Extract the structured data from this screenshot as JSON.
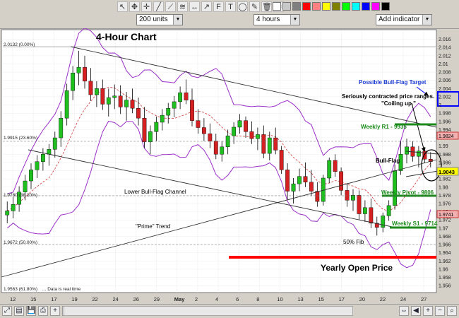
{
  "toolbar": {
    "units": "200 units",
    "interval": "4 hours",
    "indicator": "Add indicator",
    "swatches": [
      "#ffffff",
      "#c8c8c8",
      "#7f7f7f",
      "#ff0000",
      "#ff8080",
      "#ffff00",
      "#808000",
      "#00ff00",
      "#00ffff",
      "#0000ff",
      "#ff00ff",
      "#000000"
    ]
  },
  "chart_data": {
    "type": "candlestick",
    "title": "4-Hour Chart",
    "x_tick_labels": [
      "12",
      "15",
      "17",
      "19",
      "22",
      "24",
      "26",
      "29",
      "May",
      "2",
      "4",
      "6",
      "8",
      "10",
      "13",
      "15",
      "17",
      "20",
      "22",
      "24",
      "27"
    ],
    "y_tick_labels": [
      "2.016",
      "2.014",
      "2.012",
      "2.01",
      "2.008",
      "2.006",
      "2.004",
      "2.002",
      "2",
      "1.998",
      "1.996",
      "1.994",
      "1.992",
      "1.99",
      "1.988",
      "1.986",
      "1.984",
      "1.982",
      "1.98",
      "1.978",
      "1.976",
      "1.974",
      "1.972",
      "1.97",
      "1.968",
      "1.966",
      "1.964",
      "1.962",
      "1.96",
      "1.958",
      "1.956"
    ],
    "ylim": [
      1.955,
      2.018
    ],
    "level_labels": {
      "fib0": "2.0132 (0.00%)",
      "fib236": "1.9915 (23.60%)",
      "fib382": "1.9780 (38.20%)",
      "fib50": "1.9672 (50.00%)",
      "fib618": "1.9563 (61.80%)"
    },
    "price_tags": {
      "current": "1.9043",
      "r1": "1.9824",
      "s1": "1.9741"
    },
    "annotations": {
      "bull_flag_target": "Possible Bull-Flag Target",
      "contracted": "Seriously contracted price ranges.",
      "coiling": "\"Coiling up.\"",
      "weekly_r1": "Weekly R1 - 9935",
      "bull_flag": "Bull-Flag",
      "weekly_pivot": "Weekly Pivot - 9806",
      "weekly_s1": "Weekly S1 - 9714",
      "lower_channel": "Lower Bull-Flag Channel",
      "prime_trend": "\"Prime\" Trend",
      "fib50": "50% Fib",
      "yearly_open": "Yearly Open Price",
      "footer_note": "... Data is real time"
    },
    "key_levels": {
      "weekly_r1": 1.9935,
      "weekly_pivot": 1.9806,
      "weekly_s1": 1.9714,
      "yearly_open": 1.9648
    },
    "candles": [
      [
        1.9732,
        1.9765,
        1.9712,
        1.9742
      ],
      [
        1.9742,
        1.9776,
        1.9724,
        1.9758
      ],
      [
        1.9758,
        1.9802,
        1.974,
        1.9788
      ],
      [
        1.9788,
        1.983,
        1.9768,
        1.9815
      ],
      [
        1.9815,
        1.9858,
        1.9795,
        1.9842
      ],
      [
        1.9842,
        1.9878,
        1.9822,
        1.9862
      ],
      [
        1.9862,
        1.9895,
        1.984,
        1.988
      ],
      [
        1.988,
        1.9905,
        1.9852,
        1.9892
      ],
      [
        1.9892,
        1.9935,
        1.9872,
        1.992
      ],
      [
        1.992,
        1.9985,
        1.9898,
        1.9968
      ],
      [
        1.9968,
        2.0052,
        1.995,
        2.0035
      ],
      [
        2.0035,
        2.0095,
        2.0012,
        2.0078
      ],
      [
        2.0078,
        2.0132,
        2.0048,
        2.0092
      ],
      [
        2.0092,
        2.012,
        2.004,
        2.0058
      ],
      [
        2.0058,
        2.009,
        2.001,
        2.0025
      ],
      [
        2.0025,
        2.0058,
        1.9995,
        2.004
      ],
      [
        2.004,
        2.0062,
        1.9988,
        2.0002
      ],
      [
        2.0002,
        2.004,
        1.9972,
        2.0018
      ],
      [
        2.0018,
        2.005,
        1.999,
        2.0022
      ],
      [
        2.0022,
        2.0048,
        1.9978,
        1.9995
      ],
      [
        1.9995,
        2.0032,
        1.9962,
        2.0012
      ],
      [
        2.0012,
        2.004,
        1.998,
        1.9992
      ],
      [
        1.9992,
        2.0018,
        1.995,
        1.9968
      ],
      [
        1.9968,
        1.9995,
        1.9895,
        1.991
      ],
      [
        1.991,
        1.995,
        1.988,
        1.9935
      ],
      [
        1.9935,
        1.9972,
        1.9912,
        1.9958
      ],
      [
        1.9958,
        1.999,
        1.9938,
        1.9975
      ],
      [
        1.9975,
        2.0005,
        1.9955,
        1.9992
      ],
      [
        1.9992,
        2.0022,
        1.997,
        2.0008
      ],
      [
        2.0008,
        2.0045,
        1.999,
        2.003
      ],
      [
        2.003,
        2.0062,
        2.0002,
        2.0012
      ],
      [
        2.0012,
        2.004,
        1.9948,
        1.9962
      ],
      [
        1.9962,
        1.999,
        1.993,
        1.9945
      ],
      [
        1.9945,
        1.9968,
        1.9912,
        1.993
      ],
      [
        1.993,
        1.9955,
        1.9895,
        1.9912
      ],
      [
        1.9912,
        1.993,
        1.9868,
        1.988
      ],
      [
        1.988,
        1.9912,
        1.9862,
        1.9898
      ],
      [
        1.9898,
        1.994,
        1.988,
        1.9925
      ],
      [
        1.9925,
        1.9958,
        1.9905,
        1.9946
      ],
      [
        1.9946,
        1.9978,
        1.993,
        1.9962
      ],
      [
        1.9962,
        1.9972,
        1.992,
        1.9935
      ],
      [
        1.9935,
        1.996,
        1.9905,
        1.9918
      ],
      [
        1.9918,
        1.9945,
        1.989,
        1.9928
      ],
      [
        1.9928,
        1.995,
        1.987,
        1.9882
      ],
      [
        1.9882,
        1.9935,
        1.9865,
        1.992
      ],
      [
        1.992,
        1.9945,
        1.988,
        1.989
      ],
      [
        1.989,
        1.99,
        1.9832,
        1.9842
      ],
      [
        1.9842,
        1.9858,
        1.977,
        1.979
      ],
      [
        1.979,
        1.9822,
        1.976,
        1.9808
      ],
      [
        1.9808,
        1.9845,
        1.979,
        1.9826
      ],
      [
        1.9826,
        1.986,
        1.98,
        1.9812
      ],
      [
        1.9812,
        1.9842,
        1.9778,
        1.979
      ],
      [
        1.979,
        1.9812,
        1.9752,
        1.9765
      ],
      [
        1.9765,
        1.983,
        1.9755,
        1.9822
      ],
      [
        1.9822,
        1.9872,
        1.981,
        1.9865
      ],
      [
        1.9865,
        1.988,
        1.9825,
        1.9838
      ],
      [
        1.9838,
        1.9848,
        1.978,
        1.9792
      ],
      [
        1.9792,
        1.981,
        1.9752,
        1.9768
      ],
      [
        1.9768,
        1.9795,
        1.9742,
        1.978
      ],
      [
        1.978,
        1.9792,
        1.972,
        1.9735
      ],
      [
        1.9735,
        1.9768,
        1.9715,
        1.975
      ],
      [
        1.975,
        1.9772,
        1.97,
        1.9712
      ],
      [
        1.9712,
        1.9728,
        1.9682,
        1.9702
      ],
      [
        1.9702,
        1.9738,
        1.969,
        1.973
      ],
      [
        1.973,
        1.9768,
        1.9718,
        1.9755
      ],
      [
        1.9755,
        1.9855,
        1.9745,
        1.984
      ],
      [
        1.984,
        1.9912,
        1.983,
        1.988
      ],
      [
        1.988,
        1.9918,
        1.9858,
        1.9898
      ],
      [
        1.9898,
        1.9912,
        1.9862,
        1.9875
      ],
      [
        1.9875,
        1.99,
        1.9848,
        1.9888
      ],
      [
        1.9888,
        1.9898,
        1.9858,
        1.9868
      ],
      [
        1.9868,
        1.9885,
        1.9848,
        1.9862
      ]
    ],
    "grid": true,
    "legend": "none"
  },
  "bottombar": {
    "left_icons": [
      "zoom-fit-icon",
      "chart-type-icon",
      "save-icon",
      "print-icon",
      "zoom-in-icon",
      "crosshair-icon"
    ],
    "right_icons": [
      "zoom-range-icon",
      "scroll-left-icon",
      "zoom-in-icon",
      "zoom-out-icon",
      "magnify-icon"
    ]
  }
}
